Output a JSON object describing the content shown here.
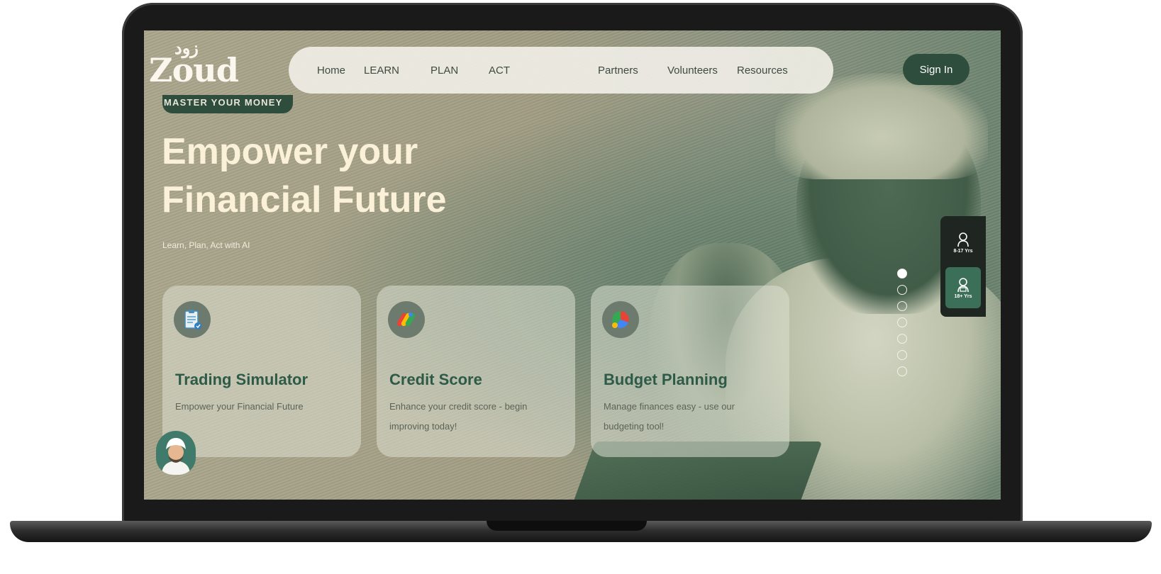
{
  "brand": {
    "logo_arabic": "زود",
    "logo_latin": "Zoud"
  },
  "nav": {
    "items": [
      {
        "label": "Home"
      },
      {
        "label": "LEARN"
      },
      {
        "label": "PLAN"
      },
      {
        "label": "ACT"
      },
      {
        "label": "Partners"
      },
      {
        "label": "Volunteers"
      },
      {
        "label": "Resources"
      }
    ],
    "signin_label": "Sign In"
  },
  "hero": {
    "badge": "MASTER YOUR MONEY",
    "title_line1": "Empower your",
    "title_line2": "Financial Future",
    "subtitle": "Learn, Plan, Act with AI"
  },
  "cards": [
    {
      "icon": "clipboard-icon",
      "title": "Trading Simulator",
      "desc": "Empower your Financial Future"
    },
    {
      "icon": "credit-score-icon",
      "title": "Credit Score",
      "desc": "Enhance your credit score - begin improving today!"
    },
    {
      "icon": "budget-chart-icon",
      "title": "Budget Planning",
      "desc": "Manage finances easy - use our budgeting tool!"
    }
  ],
  "carousel": {
    "total": 7,
    "active_index": 0
  },
  "age_switch": {
    "options": [
      {
        "label": "8-17 Yrs",
        "icon": "child-icon"
      },
      {
        "label": "18+ Yrs",
        "icon": "adult-icon"
      }
    ],
    "active_index": 1
  },
  "colors": {
    "accent": "#2e4d3c",
    "card_title": "#2e5a48",
    "hero_title": "#faf1d8"
  }
}
